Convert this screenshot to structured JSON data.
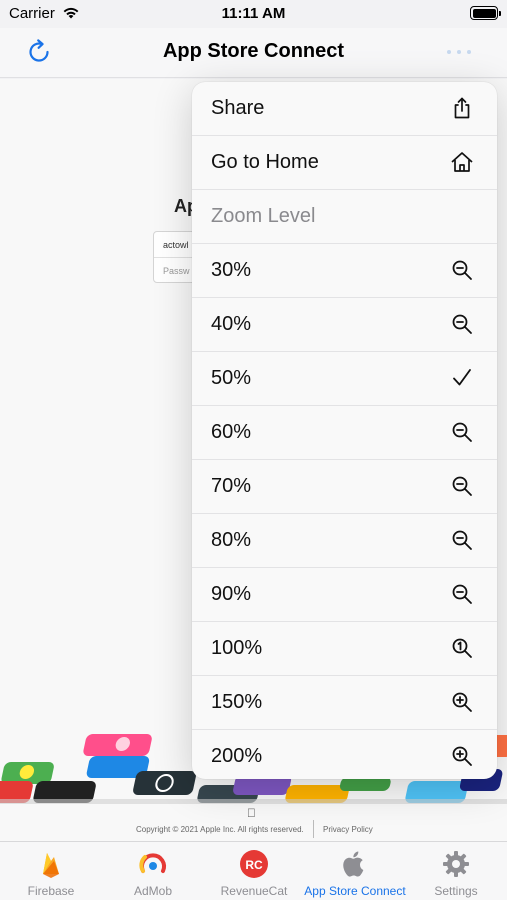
{
  "status_bar": {
    "carrier": "Carrier",
    "time": "11:11 AM"
  },
  "navbar": {
    "title": "App Store Connect"
  },
  "web": {
    "login_title": "Ap",
    "username_value": "actowl",
    "password_placeholder": "Passw",
    "footer_copyright": "Copyright © 2021 Apple Inc. All rights reserved.",
    "footer_privacy": "Privacy Policy"
  },
  "menu": {
    "items": [
      {
        "label": "Share",
        "icon": "share-icon"
      },
      {
        "label": "Go to Home",
        "icon": "home-icon"
      },
      {
        "label": "Zoom Level",
        "icon": ""
      },
      {
        "label": "30%",
        "icon": "zoom-out-icon"
      },
      {
        "label": "40%",
        "icon": "zoom-out-icon"
      },
      {
        "label": "50%",
        "icon": "checkmark-icon"
      },
      {
        "label": "60%",
        "icon": "zoom-out-icon"
      },
      {
        "label": "70%",
        "icon": "zoom-out-icon"
      },
      {
        "label": "80%",
        "icon": "zoom-out-icon"
      },
      {
        "label": "90%",
        "icon": "zoom-out-icon"
      },
      {
        "label": "100%",
        "icon": "zoom-actual-icon"
      },
      {
        "label": "150%",
        "icon": "zoom-in-icon"
      },
      {
        "label": "200%",
        "icon": "zoom-in-icon"
      }
    ],
    "selected_zoom": "50%"
  },
  "tabbar": {
    "tabs": [
      {
        "label": "Firebase",
        "icon": "firebase-icon"
      },
      {
        "label": "AdMob",
        "icon": "admob-icon"
      },
      {
        "label": "RevenueCat",
        "icon": "revenuecat-icon",
        "icon_text": "RC"
      },
      {
        "label": "App Store Connect",
        "icon": "apple-icon"
      },
      {
        "label": "Settings",
        "icon": "gear-icon"
      }
    ],
    "active_tab": "App Store Connect"
  },
  "colors": {
    "accent": "#1a73e8",
    "menu_bg": "#f9f9f9",
    "revenuecat": "#e53935",
    "firebase": "#f9a825"
  }
}
